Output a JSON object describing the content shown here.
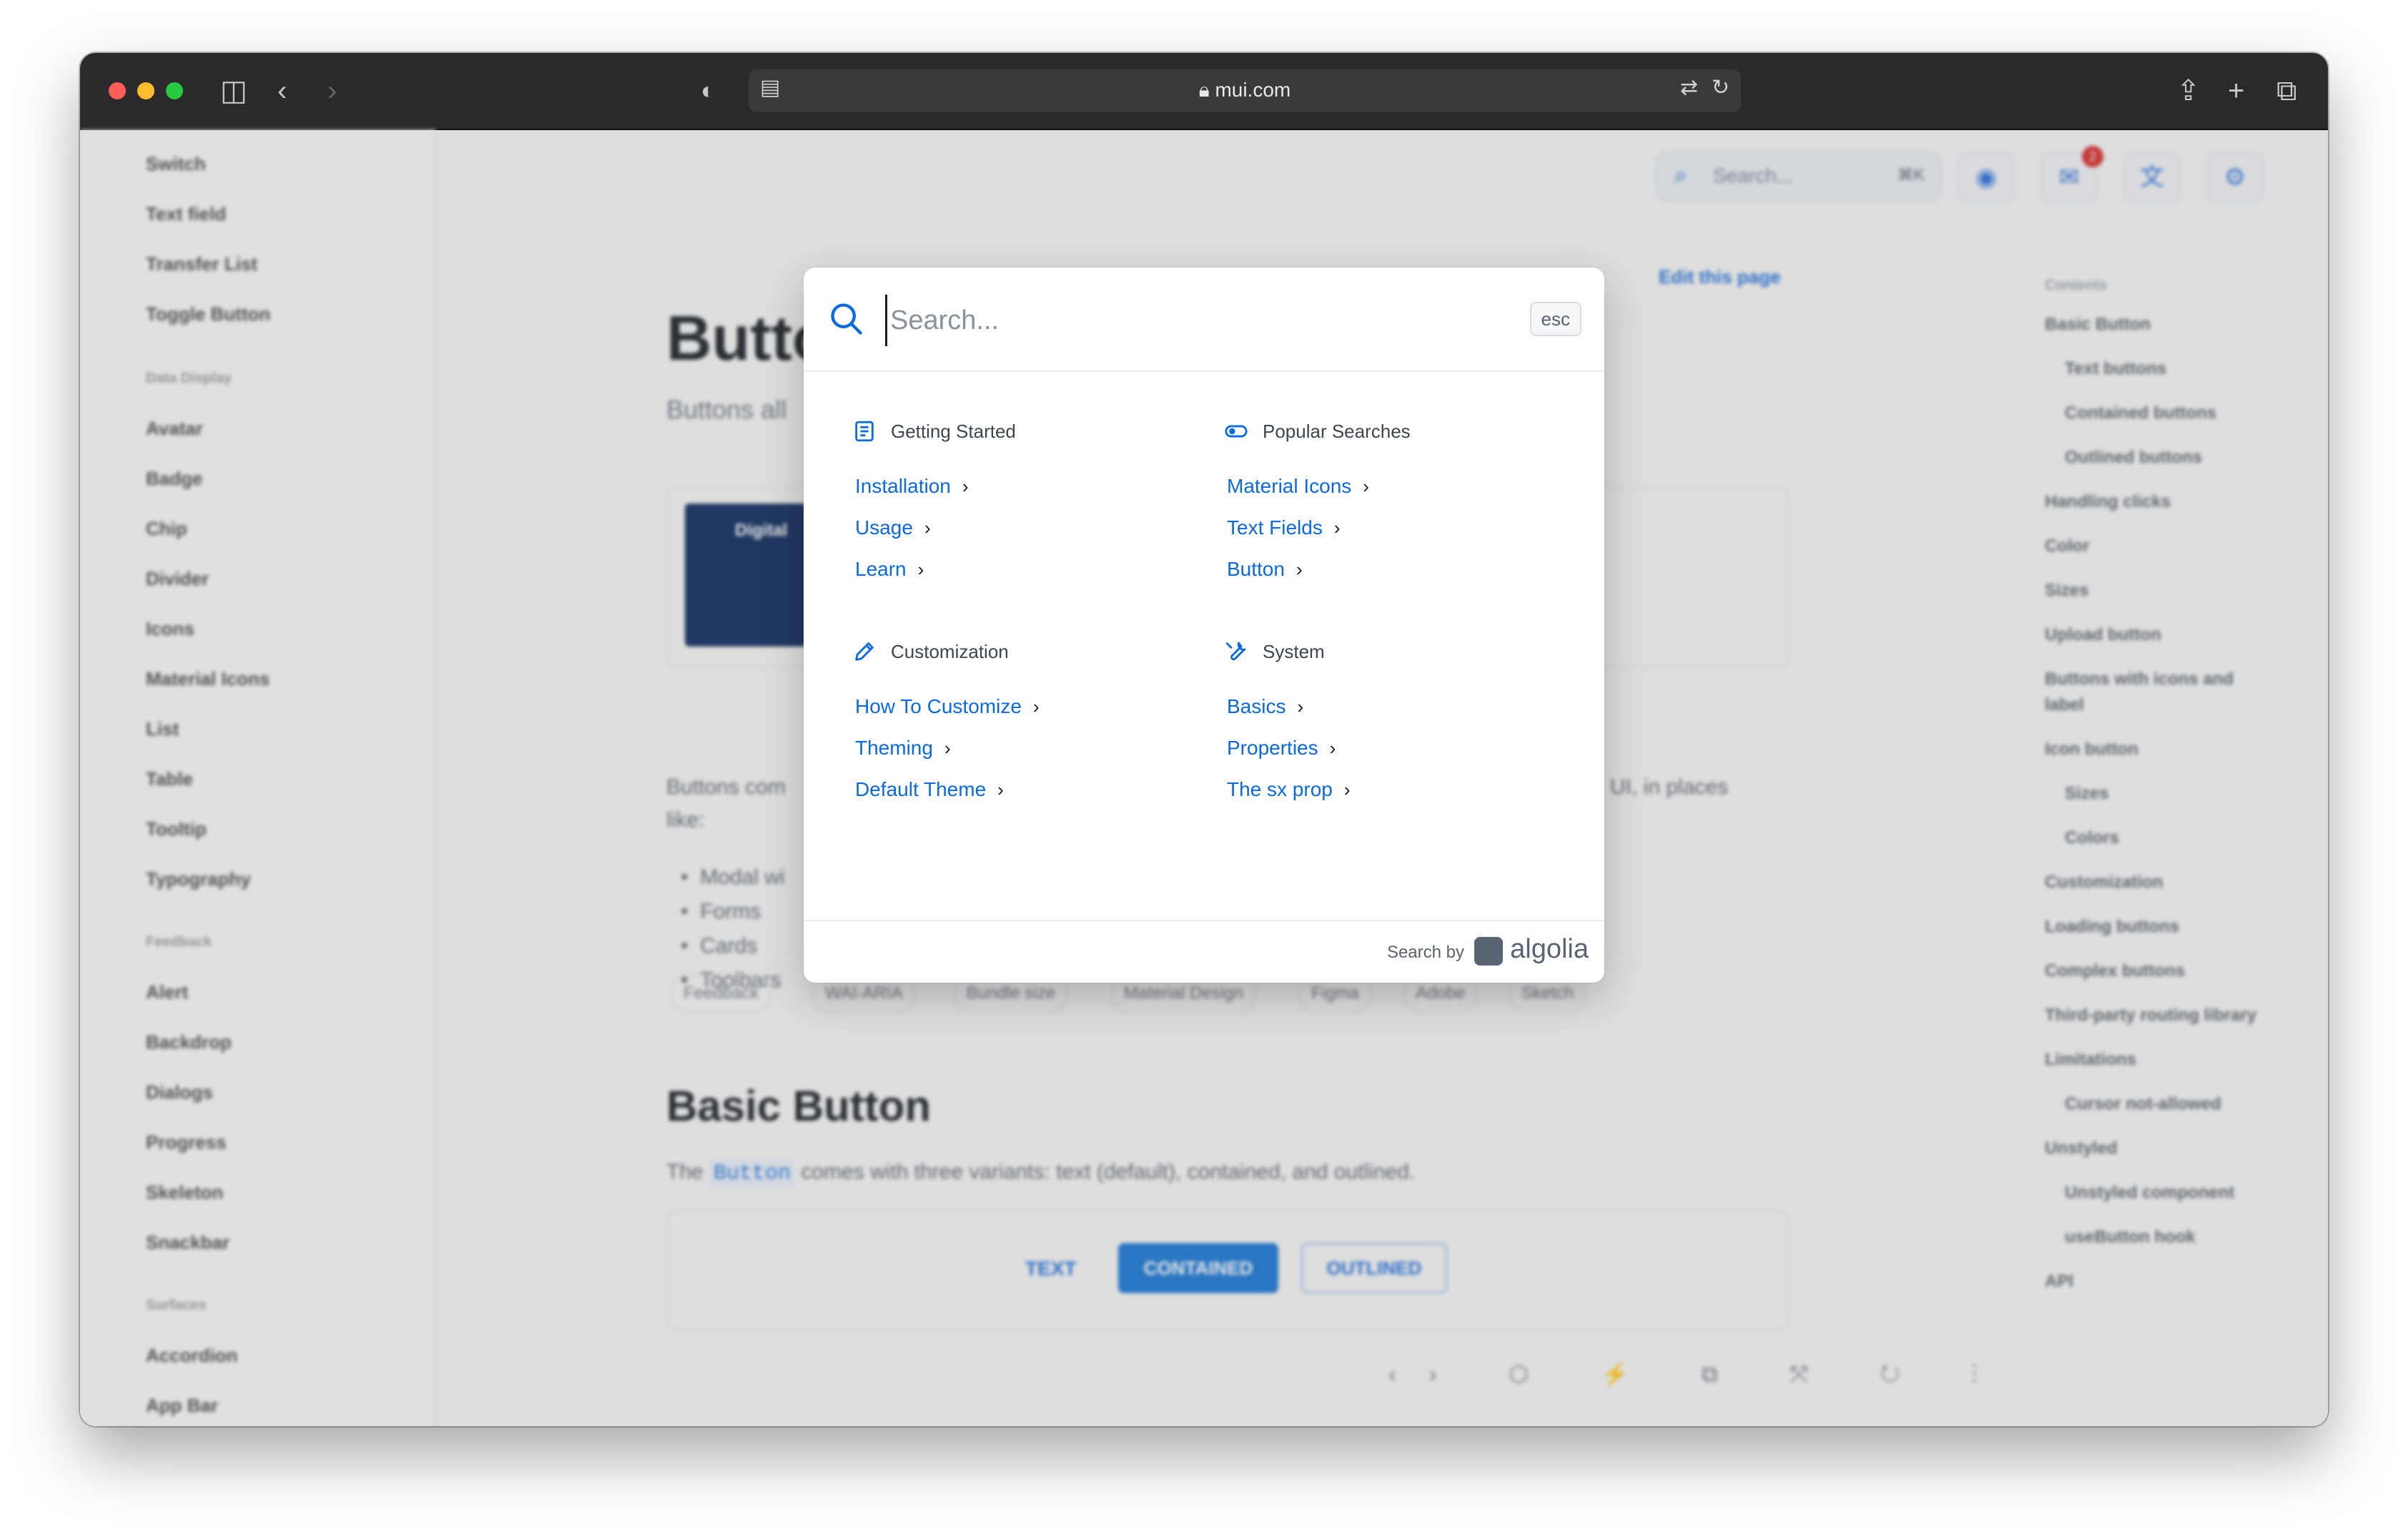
{
  "browser": {
    "url": "mui.com"
  },
  "sidebar": {
    "items_top": [
      "Switch",
      "Text field",
      "Transfer List",
      "Toggle Button"
    ],
    "heading_data_display": "Data Display",
    "items_data_display": [
      "Avatar",
      "Badge",
      "Chip",
      "Divider",
      "Icons",
      "Material Icons",
      "List",
      "Table",
      "Tooltip",
      "Typography"
    ],
    "heading_feedback": "Feedback",
    "items_feedback": [
      "Alert",
      "Backdrop",
      "Dialogs",
      "Progress",
      "Skeleton",
      "Snackbar"
    ],
    "heading_surfaces": "Surfaces",
    "items_surfaces": [
      "Accordion",
      "App Bar"
    ]
  },
  "topbar": {
    "search_placeholder": "Search...",
    "search_shortcut": "⌘K",
    "notification_count": "2"
  },
  "page": {
    "title": "Butto",
    "subtitle": "Buttons all",
    "edit_link": "Edit this page",
    "ad_text": "Digital",
    "para1": "Buttons com",
    "para1_end": "UI, in places",
    "para2": "like:",
    "bullets": [
      "Modal wi",
      "Forms",
      "Cards",
      "Toolbars"
    ],
    "chips": [
      "Feedback",
      "WAI-ARIA",
      "Bundle size",
      "Material Design",
      "Figma",
      "Adobe",
      "Sketch"
    ],
    "section_title": "Basic Button",
    "section_sub_pre": "The",
    "section_sub_code": "Button",
    "section_sub_post": "comes with three variants: text (default), contained, and outlined.",
    "demo_buttons": [
      "TEXT",
      "CONTAINED",
      "OUTLINED"
    ],
    "toolbar_glyphs": "‹› ⬡ ⚡ ⧉ ⤧ ↻ ⋮"
  },
  "toc": {
    "heading": "Contents",
    "items": [
      "Basic Button",
      "Text buttons",
      "Contained buttons",
      "Outlined buttons",
      "Handling clicks",
      "Color",
      "Sizes",
      "Upload button",
      "Buttons with icons and",
      "label",
      "Icon button",
      "Sizes",
      "Colors",
      "Customization",
      "Loading buttons",
      "Complex buttons",
      "Third-party routing library",
      "Limitations",
      "Cursor not-allowed",
      "Unstyled",
      "Unstyled component",
      "useButton hook",
      "API"
    ]
  },
  "modal": {
    "search_placeholder": "Search...",
    "esc_label": "esc",
    "categories": [
      {
        "title": "Getting Started",
        "icon": "article-icon",
        "links": [
          "Installation",
          "Usage",
          "Learn"
        ]
      },
      {
        "title": "Popular Searches",
        "icon": "toggle-icon",
        "links": [
          "Material Icons",
          "Text Fields",
          "Button"
        ]
      },
      {
        "title": "Customization",
        "icon": "pencil-icon",
        "links": [
          "How To Customize",
          "Theming",
          "Default Theme"
        ]
      },
      {
        "title": "System",
        "icon": "wrench-icon",
        "links": [
          "Basics",
          "Properties",
          "The sx prop"
        ]
      }
    ],
    "footer_search_by": "Search by",
    "footer_brand": "algolia"
  },
  "colors": {
    "link": "#0b6ae0",
    "primary": "#1976d2",
    "titlebar": "#2a2a2c"
  }
}
